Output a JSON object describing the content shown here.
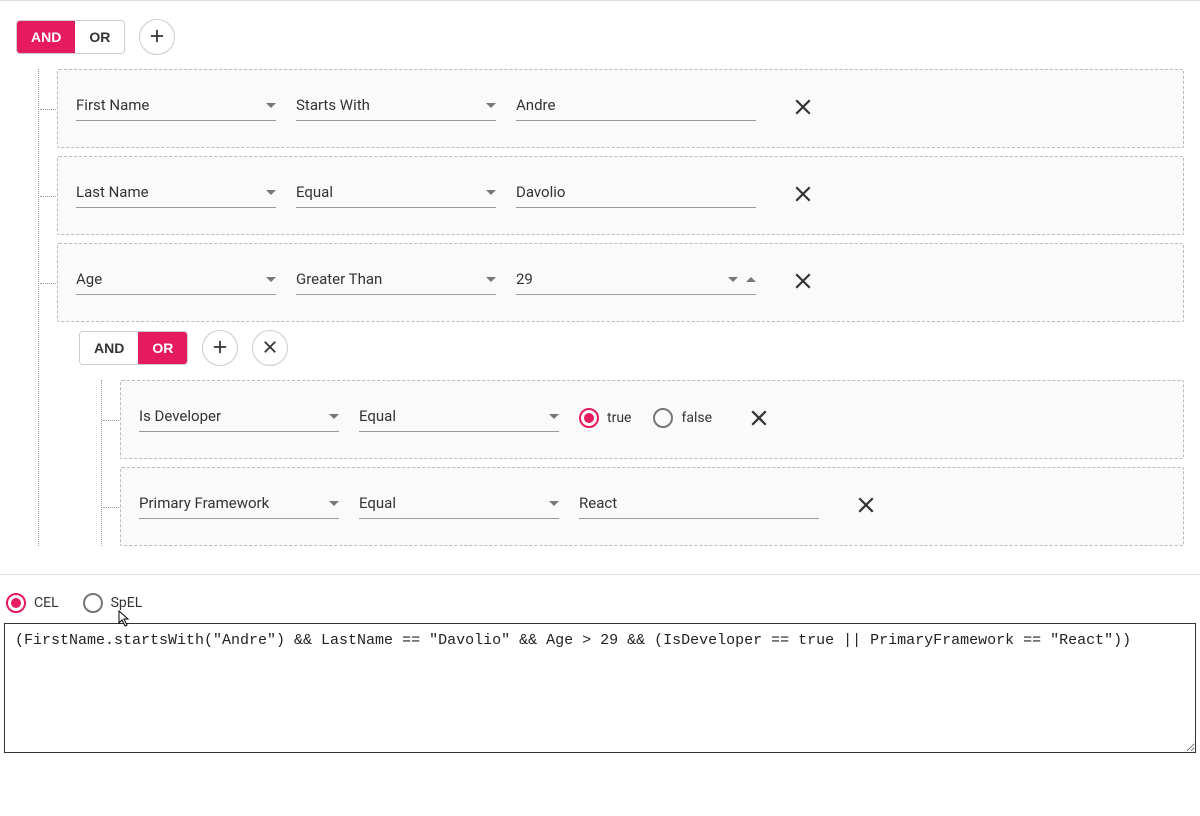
{
  "group1": {
    "andLabel": "AND",
    "orLabel": "OR",
    "active": "AND",
    "rules": [
      {
        "field": "First Name",
        "operator": "Starts With",
        "value": "Andre"
      },
      {
        "field": "Last Name",
        "operator": "Equal",
        "value": "Davolio"
      },
      {
        "field": "Age",
        "operator": "Greater Than",
        "value": "29"
      }
    ]
  },
  "group2": {
    "andLabel": "AND",
    "orLabel": "OR",
    "active": "OR",
    "rules": [
      {
        "field": "Is Developer",
        "operator": "Equal",
        "boolTrue": "true",
        "boolFalse": "false",
        "selected": "true"
      },
      {
        "field": "Primary Framework",
        "operator": "Equal",
        "value": "React"
      }
    ]
  },
  "output": {
    "opt1": "CEL",
    "opt2": "SpEL",
    "selected": "CEL",
    "expression": "(FirstName.startsWith(\"Andre\") && LastName == \"Davolio\" && Age > 29 && (IsDeveloper == true || PrimaryFramework == \"React\"))"
  }
}
